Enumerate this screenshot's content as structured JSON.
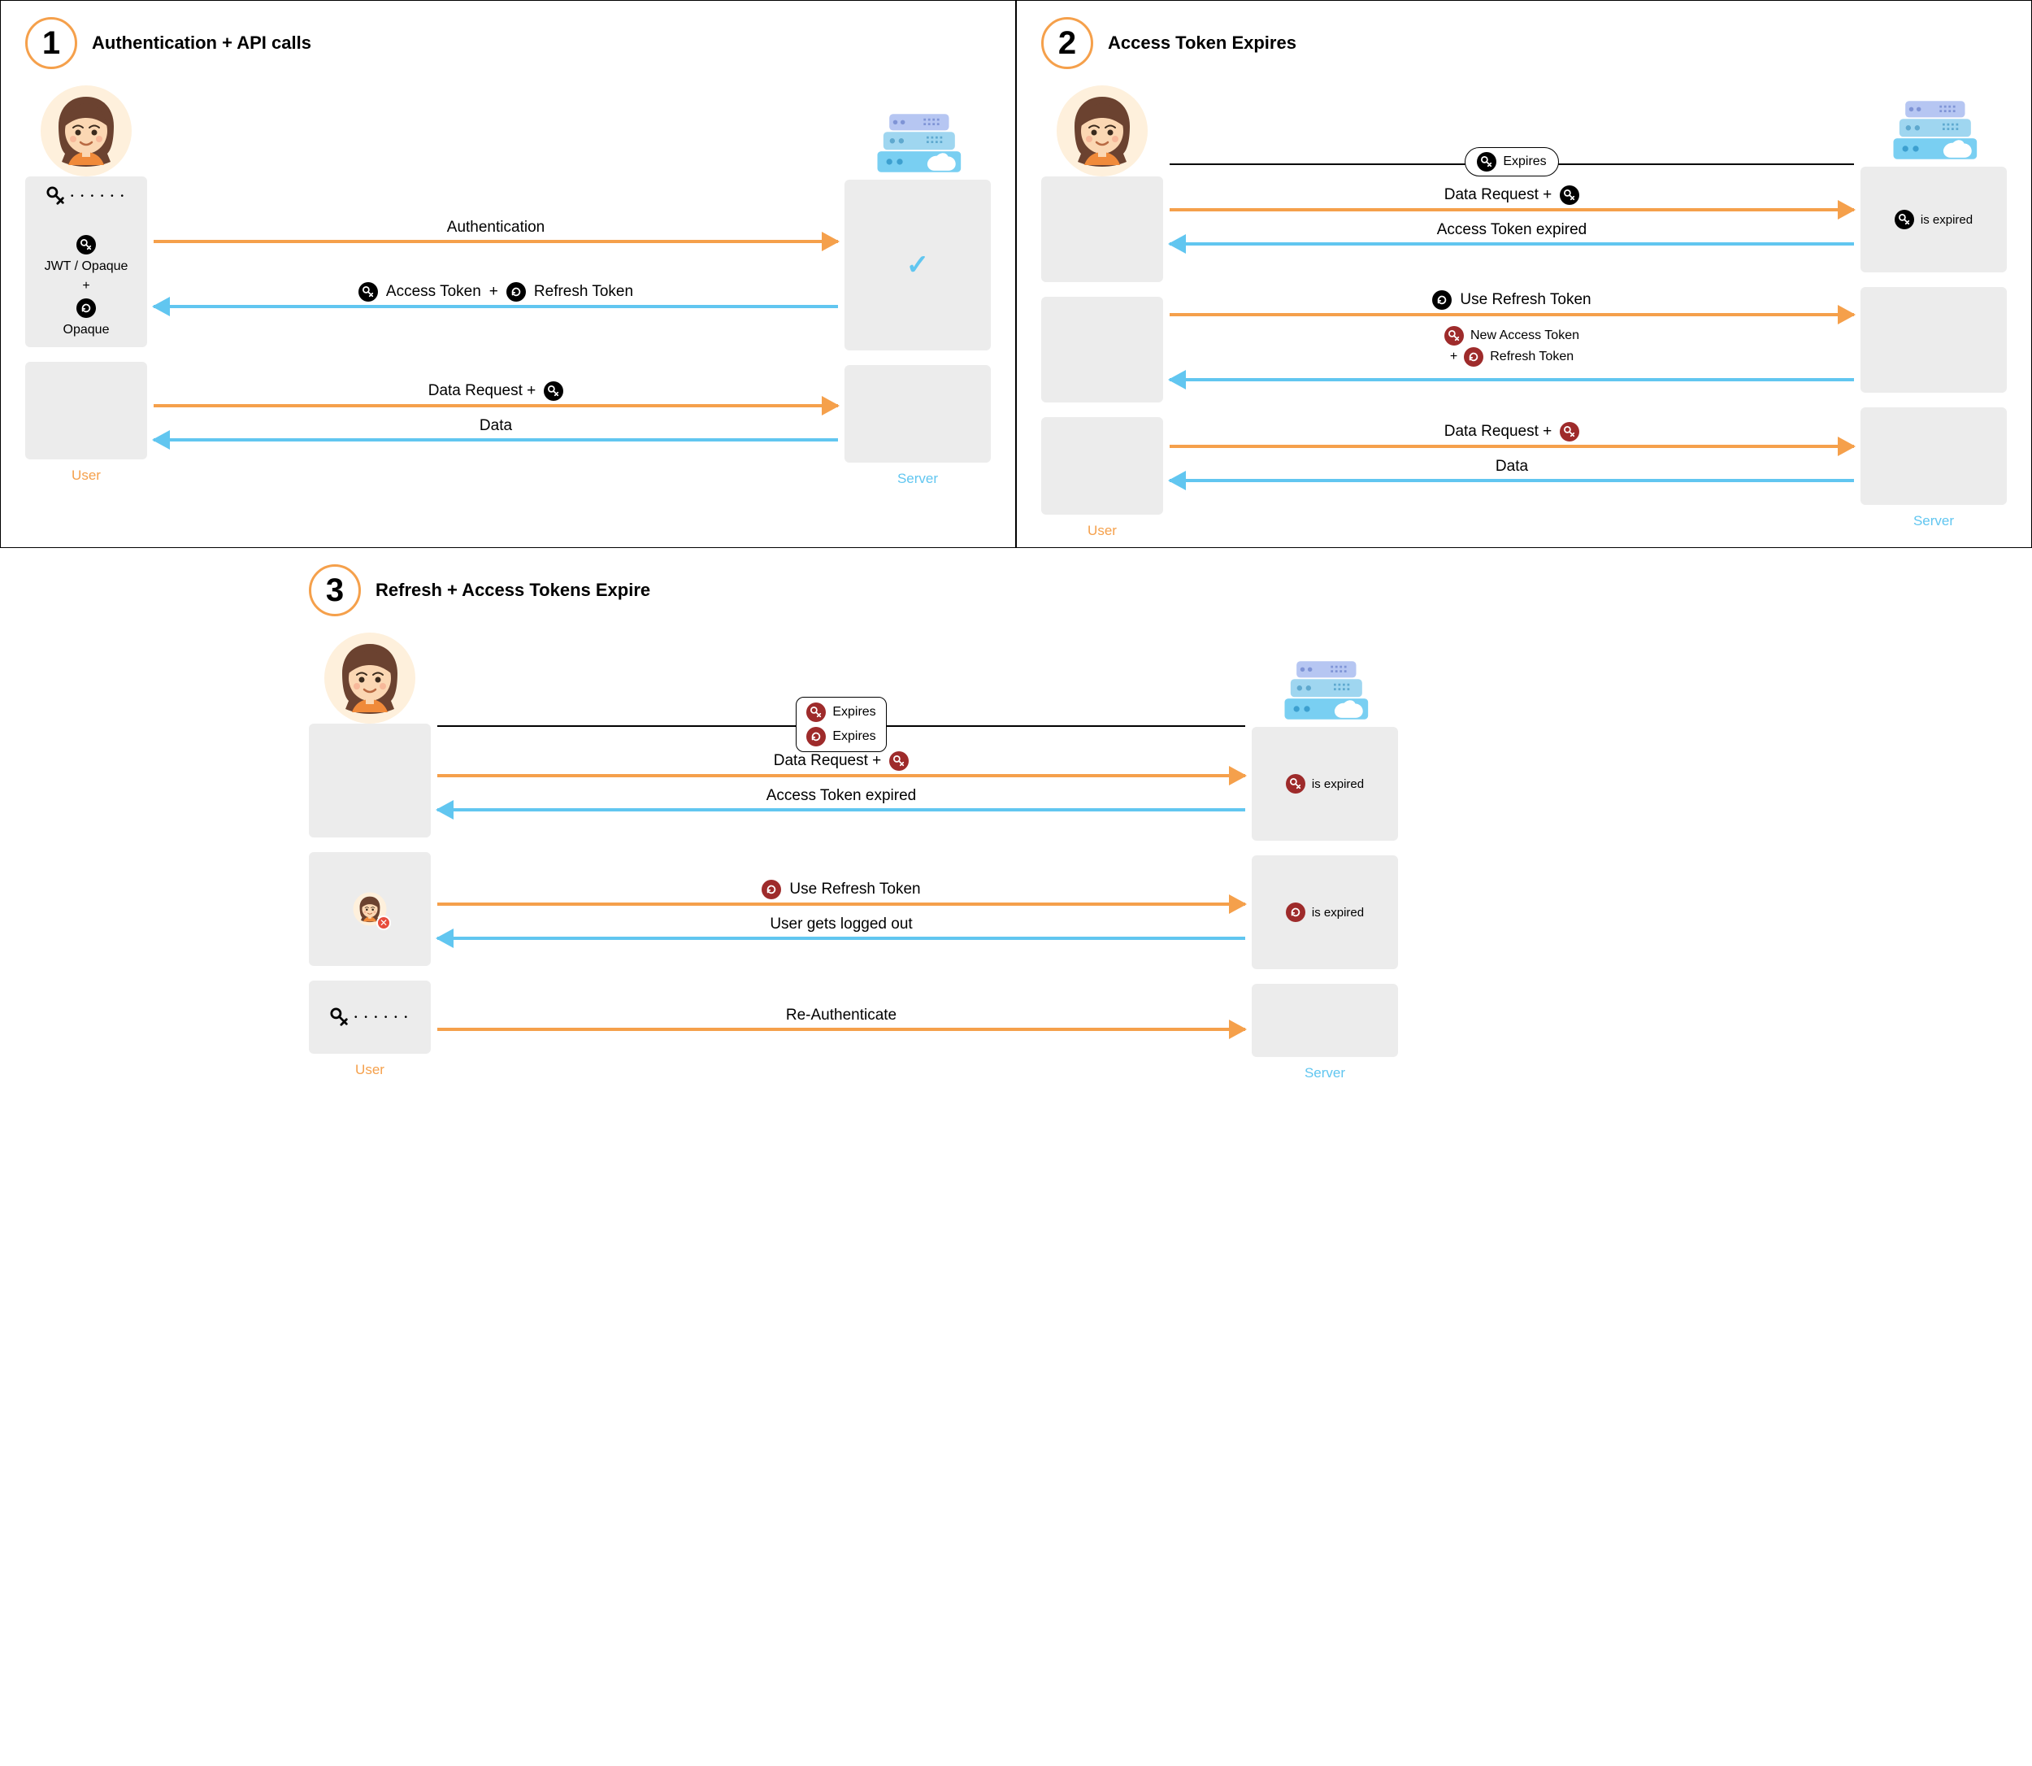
{
  "labels": {
    "user": "User",
    "server": "Server",
    "jwt_opaque": "JWT / Opaque",
    "plus": "+",
    "opaque": "Opaque",
    "is_expired": "is expired"
  },
  "panel1": {
    "num": "1",
    "title": "Authentication + API calls",
    "auth": "Authentication",
    "access_token": "Access Token",
    "refresh_token": "Refresh Token",
    "data_request": "Data Request +",
    "data": "Data"
  },
  "panel2": {
    "num": "2",
    "title": "Access Token Expires",
    "expires": "Expires",
    "data_request": "Data Request +",
    "access_expired": "Access Token expired",
    "use_refresh": "Use Refresh Token",
    "new_access": "New Access Token",
    "refresh_token": "Refresh Token",
    "data": "Data"
  },
  "panel3": {
    "num": "3",
    "title": "Refresh + Access Tokens Expire",
    "expires": "Expires",
    "data_request": "Data Request +",
    "access_expired": "Access Token expired",
    "use_refresh": "Use Refresh Token",
    "logged_out": "User gets logged out",
    "reauth": "Re-Authenticate"
  }
}
